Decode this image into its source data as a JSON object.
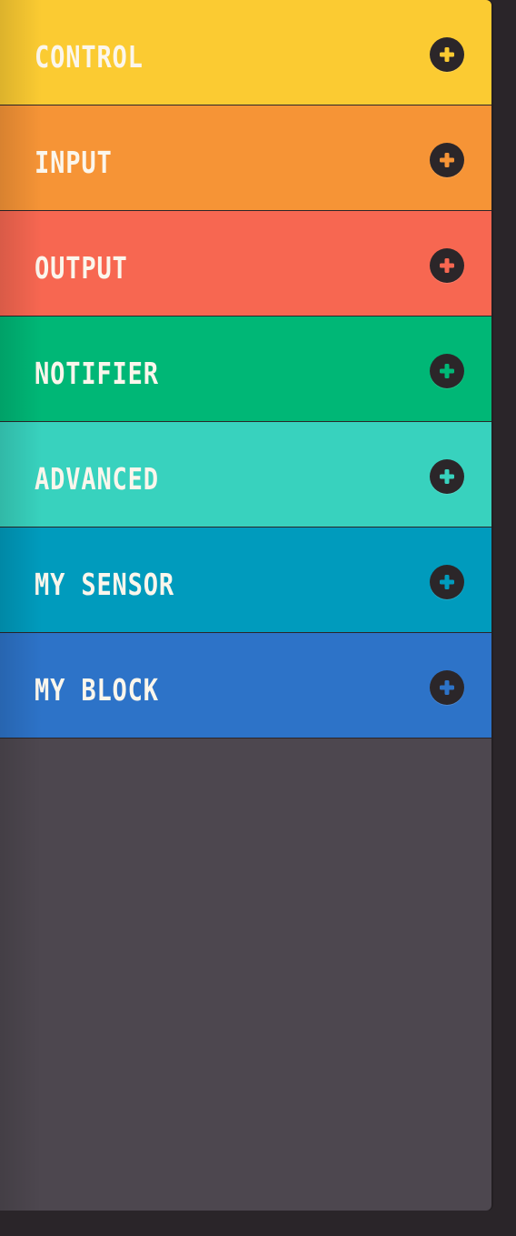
{
  "categories": [
    {
      "label": "CONTROL",
      "color": "#fbcb32",
      "icon": "plus-icon"
    },
    {
      "label": "INPUT",
      "color": "#f69436",
      "icon": "plus-icon"
    },
    {
      "label": "OUTPUT",
      "color": "#f76751",
      "icon": "plus-icon"
    },
    {
      "label": "NOTIFIER",
      "color": "#00b776",
      "icon": "plus-icon"
    },
    {
      "label": "ADVANCED",
      "color": "#38d2be",
      "icon": "plus-icon"
    },
    {
      "label": "MY SENSOR",
      "color": "#009bbd",
      "icon": "plus-icon"
    },
    {
      "label": "MY BLOCK",
      "color": "#2d73c8",
      "icon": "plus-icon"
    }
  ],
  "panel": {
    "background": "#4d474f",
    "page_background": "#2a2529"
  }
}
